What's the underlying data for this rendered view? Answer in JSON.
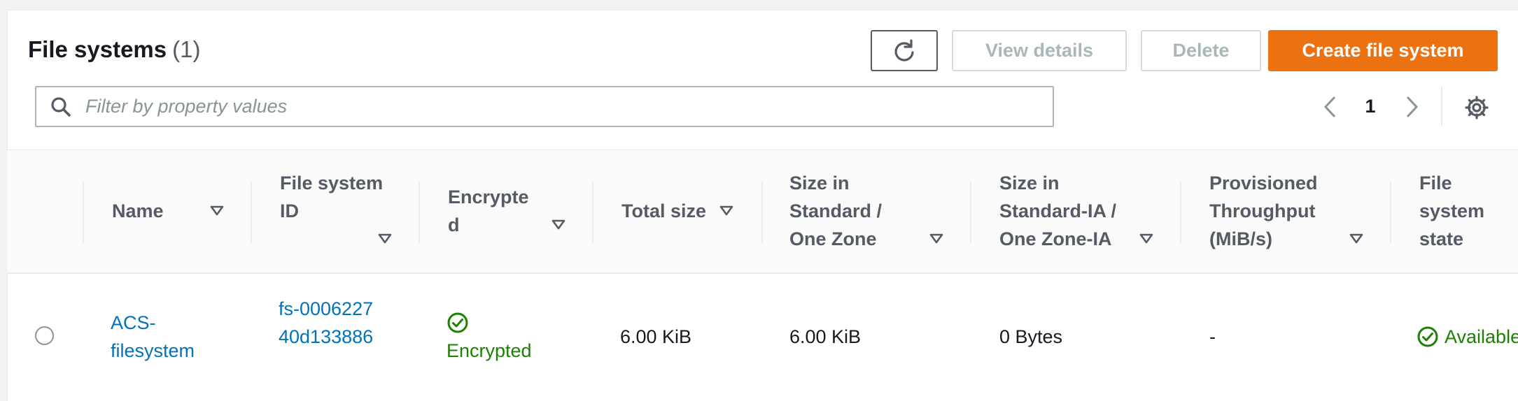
{
  "header": {
    "title": "File systems",
    "count": "(1)"
  },
  "toolbar": {
    "refresh_icon": "refresh-icon",
    "view_details_label": "View details",
    "delete_label": "Delete",
    "create_label": "Create file system"
  },
  "search": {
    "placeholder": "Filter by property values",
    "value": ""
  },
  "pagination": {
    "current_page": "1"
  },
  "table": {
    "columns": [
      {
        "label": "Name"
      },
      {
        "label": "File system ID"
      },
      {
        "label": "Encrypted"
      },
      {
        "label": "Total size"
      },
      {
        "label": "Size in Standard / One Zone"
      },
      {
        "label": "Size in Standard-IA / One Zone-IA"
      },
      {
        "label": "Provisioned Throughput (MiB/s)"
      },
      {
        "label": "File system state"
      }
    ],
    "rows": [
      {
        "selected": false,
        "name": "ACS-filesystem",
        "file_system_id": "fs-000622740d133886",
        "encrypted": "Encrypted",
        "total_size": "6.00 KiB",
        "size_standard": "6.00 KiB",
        "size_ia": "0 Bytes",
        "provisioned_throughput": "-",
        "state": "Available"
      }
    ]
  },
  "colors": {
    "primary_button": "#ec7211",
    "link": "#0073bb",
    "success": "#1d8102",
    "disabled_text": "#aab7b8"
  }
}
